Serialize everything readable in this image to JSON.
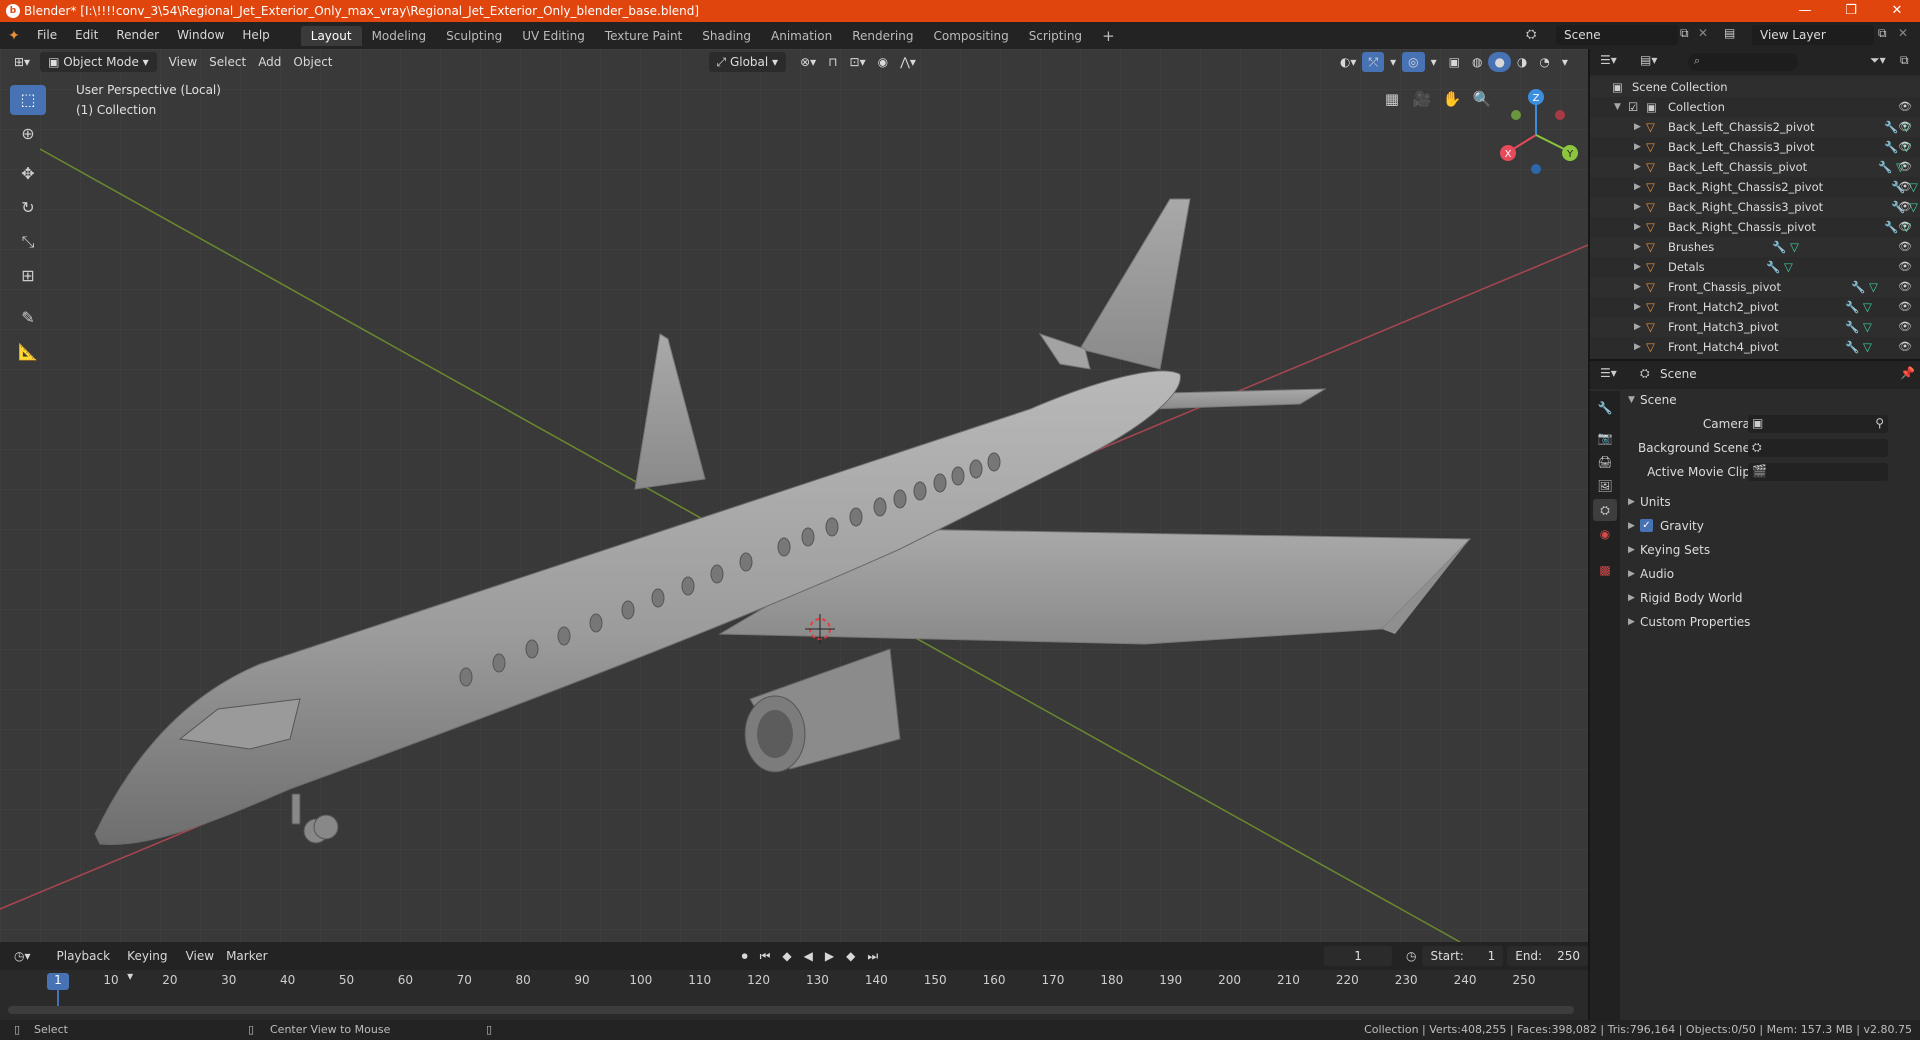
{
  "titlebar": {
    "title": "Blender* [I:\\!!!!conv_3\\54\\Regional_Jet_Exterior_Only_max_vray\\Regional_Jet_Exterior_Only_blender_base.blend]",
    "minimize": "—",
    "maximize": "❐",
    "close": "✕"
  },
  "menubar": {
    "menus": [
      "File",
      "Edit",
      "Render",
      "Window",
      "Help"
    ],
    "workspaces": [
      "Layout",
      "Modeling",
      "Sculpting",
      "UV Editing",
      "Texture Paint",
      "Shading",
      "Animation",
      "Rendering",
      "Compositing",
      "Scripting"
    ],
    "active_workspace": "Layout",
    "add_tab": "+",
    "scene_label": "Scene",
    "view_layer_label": "View Layer"
  },
  "viewport": {
    "mode": "Object Mode",
    "menus": [
      "View",
      "Select",
      "Add",
      "Object"
    ],
    "orientation": "Global",
    "perspective": "User Perspective (Local)",
    "collection": "(1) Collection",
    "gizmo": {
      "x": "X",
      "y": "Y",
      "z": "Z"
    }
  },
  "outliner": {
    "root": "Scene Collection",
    "collection": "Collection",
    "items": [
      "Back_Left_Chassis2_pivot",
      "Back_Left_Chassis3_pivot",
      "Back_Left_Chassis_pivot",
      "Back_Right_Chassis2_pivot",
      "Back_Right_Chassis3_pivot",
      "Back_Right_Chassis_pivot",
      "Brushes",
      "Detals",
      "Front_Chassis_pivot",
      "Front_Hatch2_pivot",
      "Front_Hatch3_pivot",
      "Front_Hatch4_pivot"
    ]
  },
  "properties": {
    "context": "Scene",
    "panel": "Scene",
    "camera_label": "Camera",
    "background_scene_label": "Background Scene",
    "active_movie_clip_label": "Active Movie Clip",
    "sections": [
      "Units",
      "Gravity",
      "Keying Sets",
      "Audio",
      "Rigid Body World",
      "Custom Properties"
    ]
  },
  "timeline": {
    "menus": [
      "Playback",
      "Keying",
      "View",
      "Marker"
    ],
    "current_frame": "1",
    "start_label": "Start:",
    "start": "1",
    "end_label": "End:",
    "end": "250",
    "ticks": [
      "1",
      "10",
      "20",
      "30",
      "40",
      "50",
      "60",
      "70",
      "80",
      "90",
      "100",
      "110",
      "120",
      "130",
      "140",
      "150",
      "160",
      "170",
      "180",
      "190",
      "200",
      "210",
      "220",
      "230",
      "240",
      "250"
    ]
  },
  "statusbar": {
    "select": "Select",
    "center_view": "Center View to Mouse",
    "stats": "Collection | Verts:408,255 | Faces:398,082 | Tris:796,164 | Objects:0/50 | Mem: 157.3 MB | v2.80.75"
  },
  "colors": {
    "titlebar": "#e0450e",
    "accent": "#4772b3",
    "axis_x": "#e74a5a",
    "axis_y": "#8cc63f",
    "axis_z": "#3b8de0",
    "object_orange": "#e8913c",
    "modifier_blue": "#5a9ee8",
    "mesh_green": "#3fd1a0"
  }
}
